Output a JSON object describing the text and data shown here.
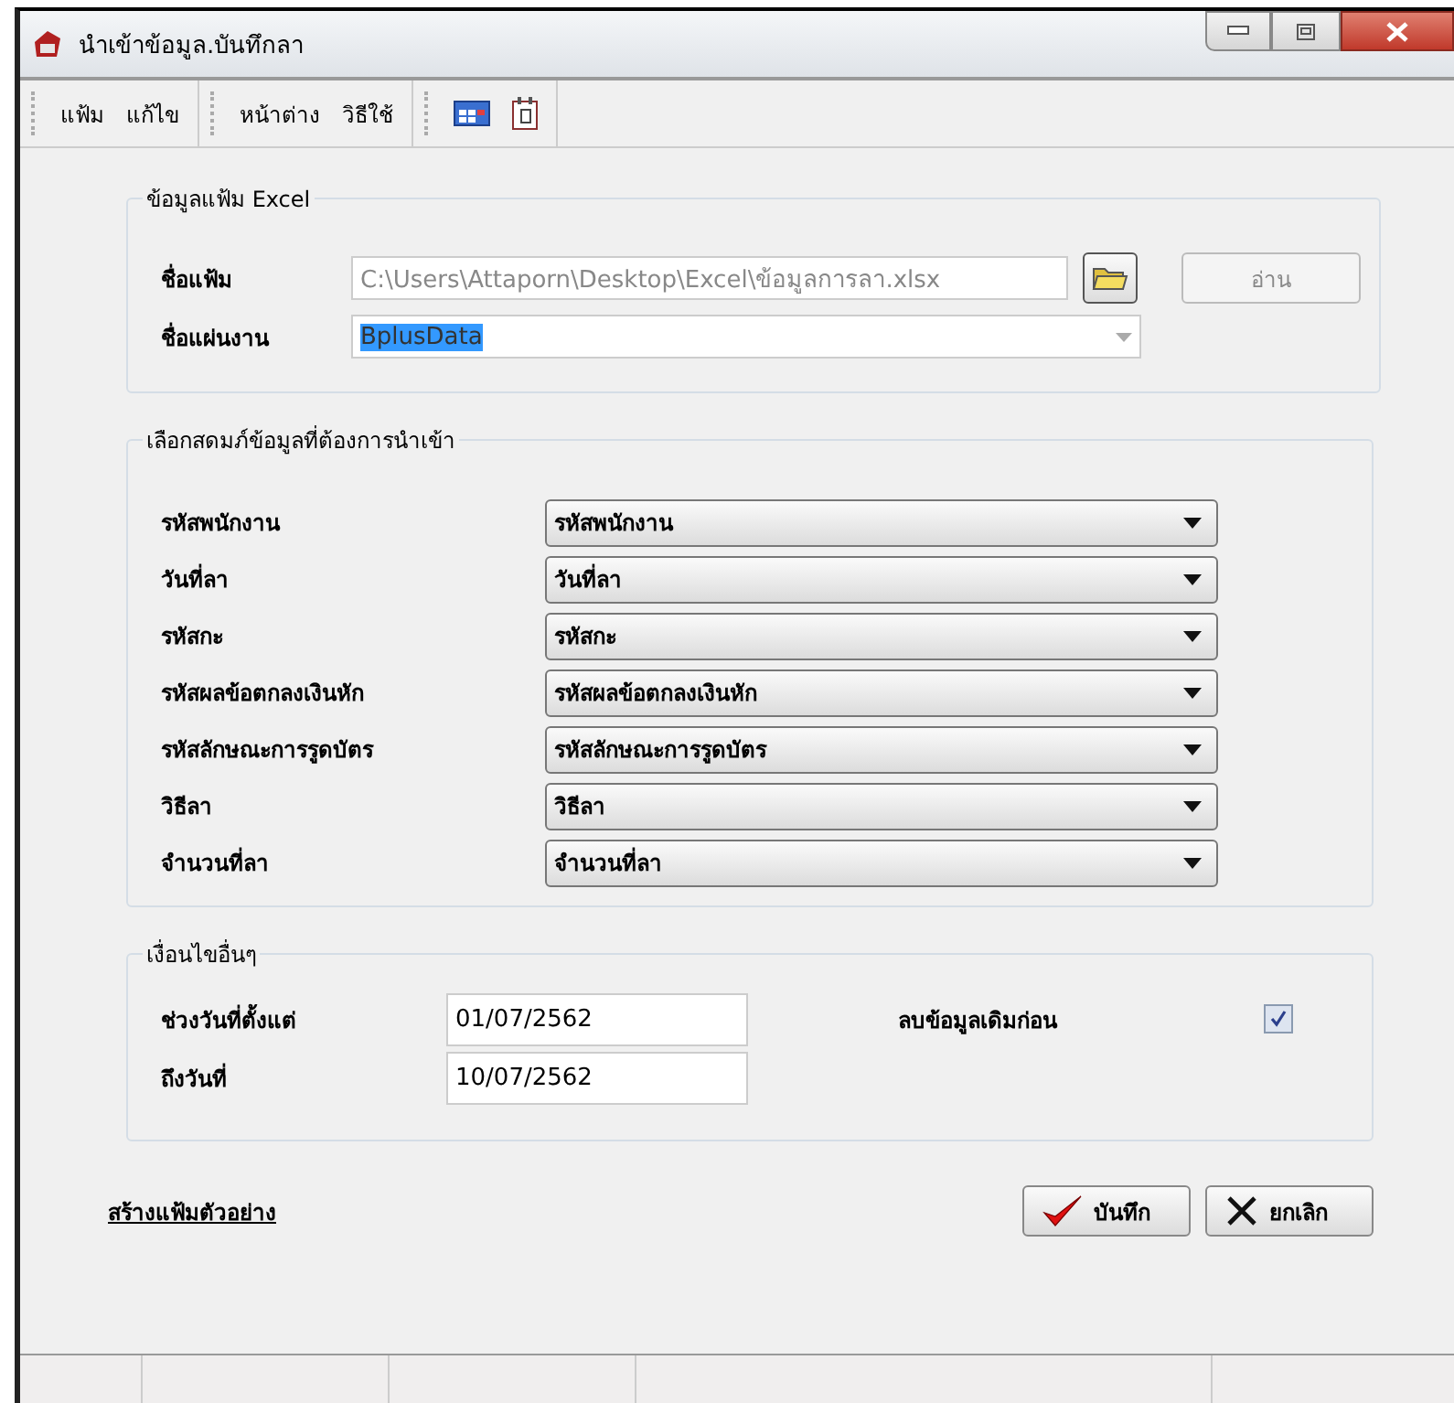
{
  "window": {
    "title": "นำเข้าข้อมูล.บันทึกลา"
  },
  "menu": [
    {
      "label": "แฟ้ม"
    },
    {
      "label": "แก้ไข"
    },
    {
      "label": "หน้าต่าง"
    },
    {
      "label": "วิธีใช้"
    }
  ],
  "excel_group": {
    "title": "ข้อมูลแฟ้ม Excel",
    "file_label": "ชื่อแฟ้ม",
    "file_value": "C:\\Users\\Attaporn\\Desktop\\Excel\\ข้อมูลการลา.xlsx",
    "read_button": {
      "label": "อ่าน",
      "disabled": true
    },
    "sheet_label": "ชื่อแผ่นงาน",
    "sheet_value": "BplusData",
    "sheet_text_selected": true
  },
  "mapping_group": {
    "title": "เลือกสดมภ์ข้อมูลที่ต้องการนำเข้า",
    "rows": [
      {
        "label": "รหัสพนักงาน",
        "value": "รหัสพนักงาน"
      },
      {
        "label": "วันที่ลา",
        "value": "วันที่ลา"
      },
      {
        "label": "รหัสกะ",
        "value": "รหัสกะ"
      },
      {
        "label": "รหัสผลข้อตกลงเงินหัก",
        "value": "รหัสผลข้อตกลงเงินหัก"
      },
      {
        "label": "รหัสลักษณะการรูดบัตร",
        "value": "รหัสลักษณะการรูดบัตร"
      },
      {
        "label": "วิธีลา",
        "value": "วิธีลา"
      },
      {
        "label": "จำนวนที่ลา",
        "value": "จำนวนที่ลา"
      }
    ]
  },
  "conditions_group": {
    "title": "เงื่อนไขอื่นๆ",
    "from_label": "ช่วงวันที่ตั้งแต่",
    "from_value": "01/07/2562",
    "to_label": "ถึงวันที่",
    "to_value": "10/07/2562",
    "delete_label": "ลบข้อมูลเดิมก่อน",
    "delete_checked": true
  },
  "sample_link": "สร้างแฟ้มตัวอย่าง",
  "buttons": [
    {
      "kind": "save",
      "label": "บันทึก"
    },
    {
      "kind": "cancel",
      "label": "ยกเลิก"
    }
  ]
}
